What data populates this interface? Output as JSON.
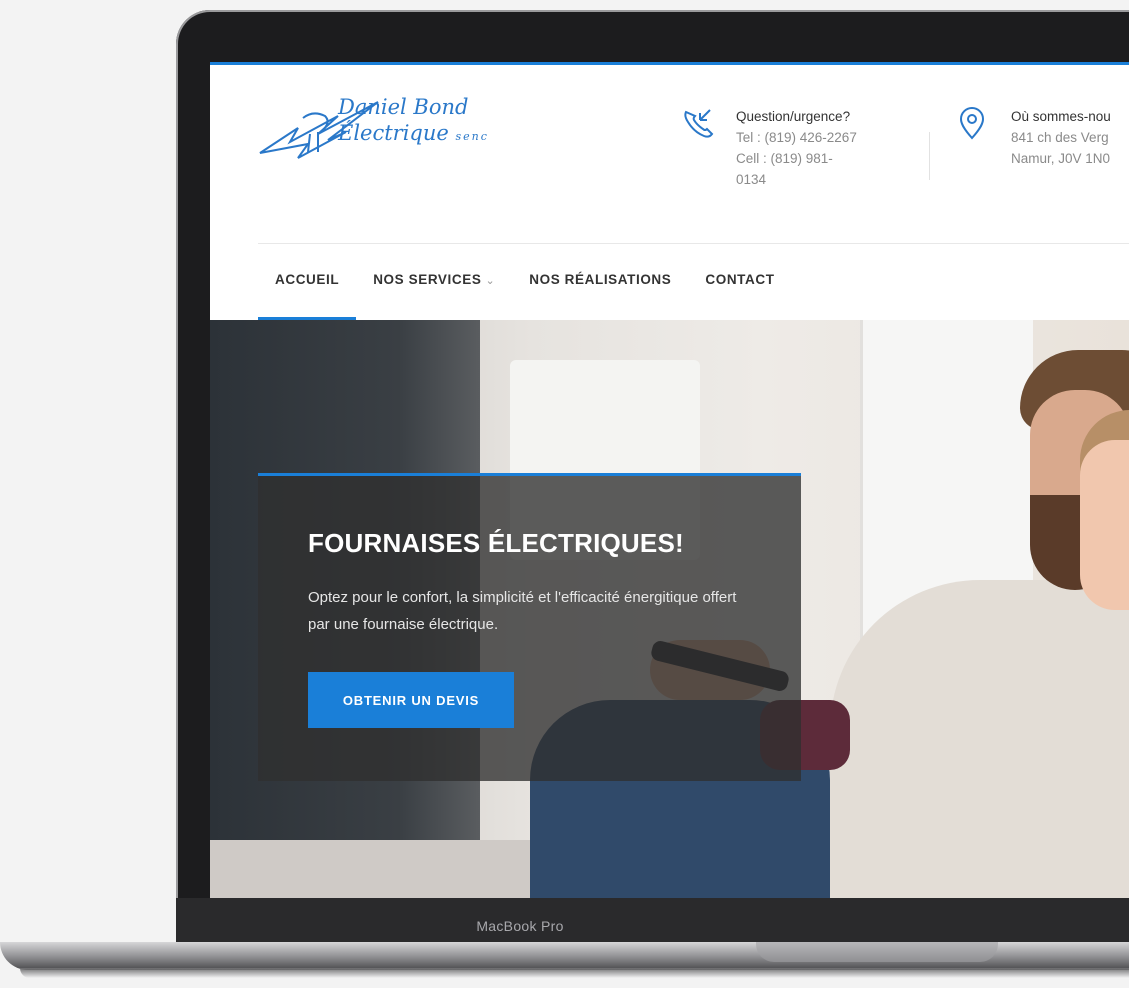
{
  "device": {
    "label": "MacBook Pro"
  },
  "logo": {
    "line1": "Daniel Bond",
    "line2": "Électrique",
    "line3": "senc"
  },
  "header": {
    "contact_phone": {
      "title": "Question/urgence?",
      "tel": "Tel : (819) 426-2267",
      "cell": "Cell : (819) 981-",
      "cell2": "0134"
    },
    "contact_location": {
      "title": "Où sommes-nou",
      "address1": "841 ch des Verg",
      "address2": "Namur, J0V 1N0"
    }
  },
  "nav": {
    "items": [
      {
        "label": "ACCUEIL",
        "active": true
      },
      {
        "label": "NOS SERVICES",
        "dropdown": true,
        "chevron": "⌄"
      },
      {
        "label": "NOS RÉALISATIONS"
      },
      {
        "label": "CONTACT"
      }
    ]
  },
  "hero": {
    "title": "FOURNAISES ÉLECTRIQUES!",
    "description": "Optez pour le confort, la simplicité et l'efficacité énergitique offert par une fournaise électrique.",
    "cta_label": "OBTENIR UN DEVIS"
  },
  "colors": {
    "accent": "#1a7fd8",
    "text_dark": "#333333",
    "text_muted": "#8a8a8a"
  },
  "icons": {
    "phone": "phone-incoming-icon",
    "location": "map-pin-icon"
  }
}
